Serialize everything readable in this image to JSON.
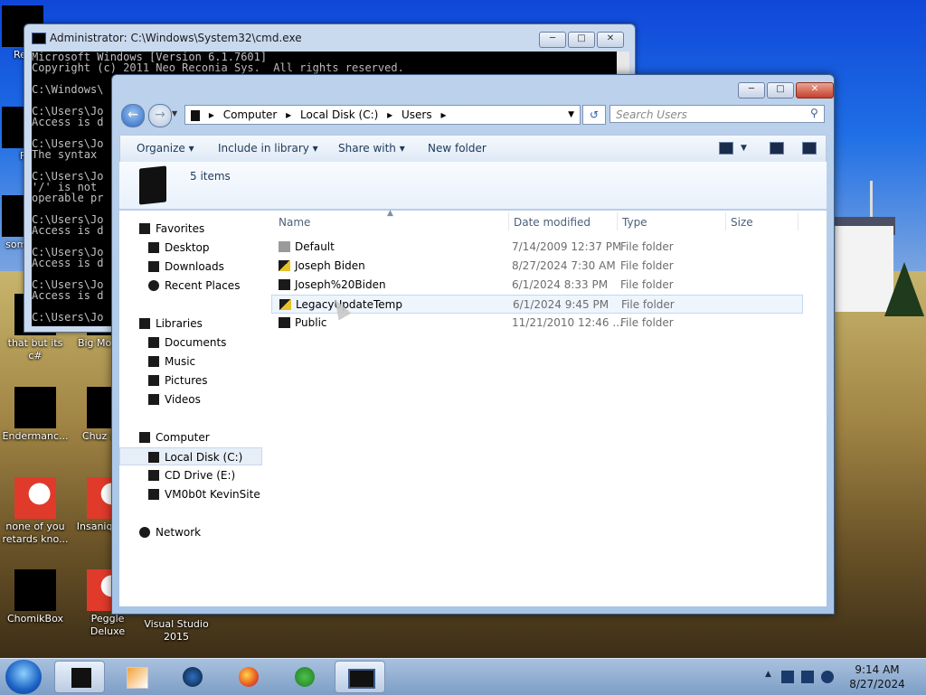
{
  "desktop": {
    "icons": [
      {
        "label": "Rec"
      },
      {
        "label": "F"
      },
      {
        "label": "som re"
      },
      {
        "label": "that but its c#"
      },
      {
        "label": "Big Mo Delu"
      },
      {
        "label": "Endermanc..."
      },
      {
        "label": "Chuz Delu"
      },
      {
        "label": "none of you retards kno..."
      },
      {
        "label": "Insaniq Delu"
      },
      {
        "label": "ChomikBox"
      },
      {
        "label": "Peggle Deluxe"
      },
      {
        "label": "Visual Studio 2015"
      }
    ]
  },
  "cmd": {
    "title": "Administrator: C:\\Windows\\System32\\cmd.exe",
    "lines": [
      "Microsoft Windows [Version 6.1.7601]",
      "Copyright (c) 2011 Neo Reconia Sys.  All rights reserved.",
      "",
      "C:\\Windows\\",
      "",
      "C:\\Users\\Jo",
      "Access is d",
      "",
      "C:\\Users\\Jo",
      "The syntax",
      "",
      "C:\\Users\\Jo",
      "'/' is not",
      "operable pr",
      "",
      "C:\\Users\\Jo",
      "Access is d",
      "",
      "C:\\Users\\Jo",
      "Access is d",
      "",
      "C:\\Users\\Jo",
      "Access is d",
      "",
      "C:\\Users\\Jo"
    ]
  },
  "explorer": {
    "breadcrumb": [
      "Computer",
      "Local Disk (C:)",
      "Users"
    ],
    "search_placeholder": "Search Users",
    "toolbar": {
      "organize": "Organize",
      "include": "Include in library",
      "share": "Share with",
      "new_folder": "New folder"
    },
    "item_count": "5 items",
    "nav": {
      "favorites": "Favorites",
      "desktop": "Desktop",
      "downloads": "Downloads",
      "recent": "Recent Places",
      "libraries": "Libraries",
      "documents": "Documents",
      "music": "Music",
      "pictures": "Pictures",
      "videos": "Videos",
      "computer": "Computer",
      "local_disk": "Local Disk (C:)",
      "cd_drive": "CD Drive (E:)",
      "vm": "VM0b0t KevinSite",
      "network": "Network"
    },
    "columns": {
      "name": "Name",
      "date": "Date modified",
      "type": "Type",
      "size": "Size"
    },
    "files": [
      {
        "name": "Default",
        "date": "7/14/2009 12:37 PM",
        "type": "File folder"
      },
      {
        "name": "Joseph Biden",
        "date": "8/27/2024 7:30 AM",
        "type": "File folder"
      },
      {
        "name": "Joseph%20Biden",
        "date": "6/1/2024 8:33 PM",
        "type": "File folder"
      },
      {
        "name": "LegacyUpdateTemp",
        "date": "6/1/2024 9:45 PM",
        "type": "File folder"
      },
      {
        "name": "Public",
        "date": "11/21/2010 12:46 ...",
        "type": "File folder"
      }
    ]
  },
  "taskbar": {
    "time": "9:14 AM",
    "date": "8/27/2024"
  }
}
